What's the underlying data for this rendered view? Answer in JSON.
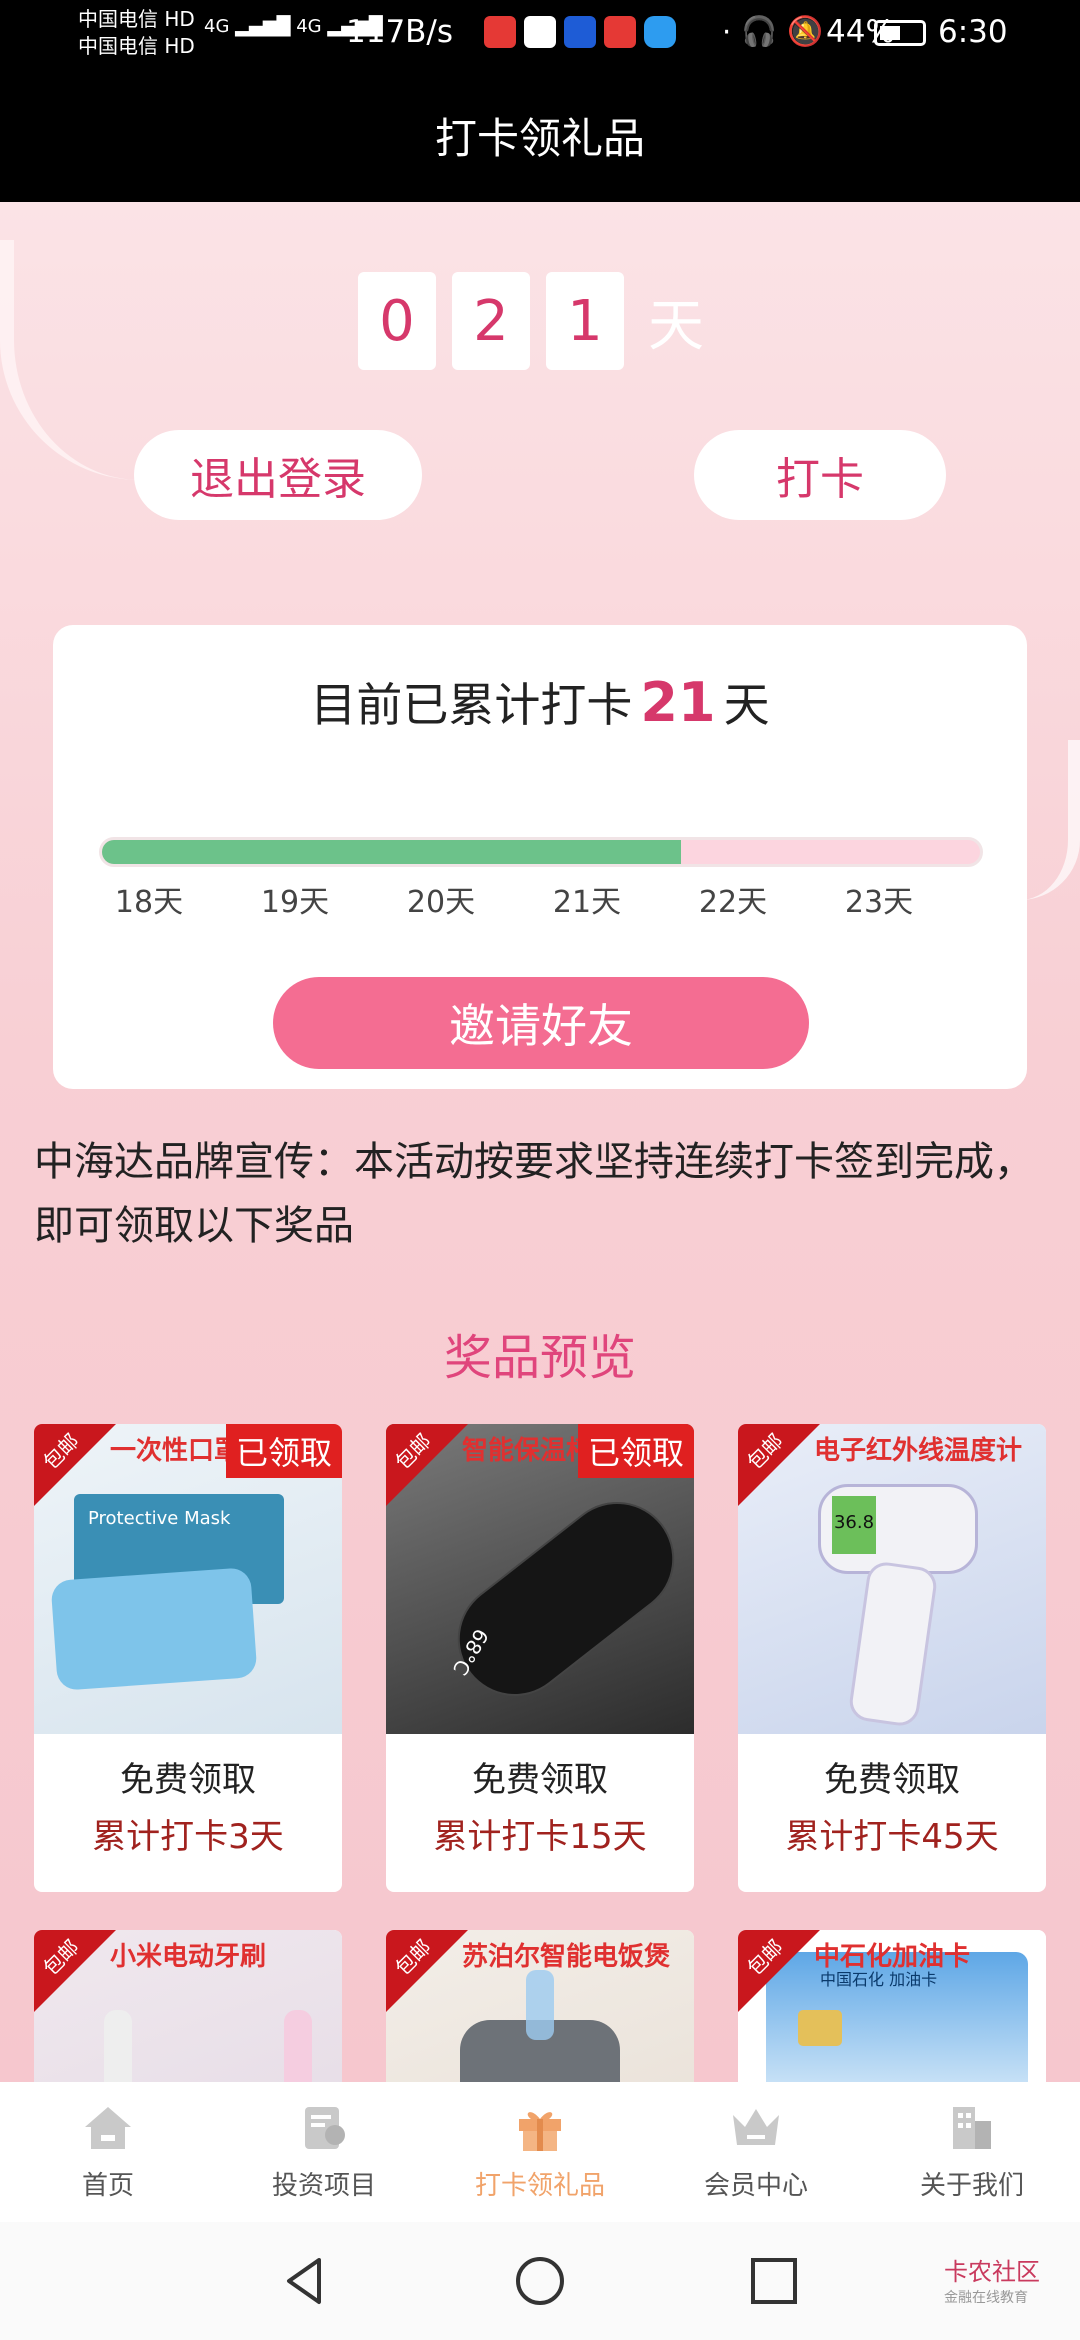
{
  "status_bar": {
    "carrier1": "中国电信",
    "carrier2": "中国电信",
    "hd": "HD",
    "network": "4G",
    "speed": "117B/s",
    "battery": "44%",
    "time": "6:30"
  },
  "title": "打卡领礼品",
  "counter": {
    "digits": [
      "0",
      "2",
      "1"
    ],
    "unit": "天"
  },
  "buttons": {
    "logout": "退出登录",
    "checkin": "打卡"
  },
  "progress_card": {
    "title_prefix": "目前已累计打卡",
    "days": "21",
    "title_suffix": "天",
    "progress_fraction": 0.66,
    "ticks": [
      "18天",
      "19天",
      "20天",
      "21天",
      "22天",
      "23天"
    ],
    "invite": "邀请好友"
  },
  "description": "中海达品牌宣传：本活动按要求坚持连续打卡签到完成，即可领取以下奖品",
  "section_title": "奖品预览",
  "prizes": [
    {
      "tag": "包邮",
      "name": "一次性口罩",
      "claimed": "已领取",
      "free": "免费领取",
      "req": "累计打卡3天",
      "image_text": "Protective Mask"
    },
    {
      "tag": "包邮",
      "name": "智能保温杯",
      "claimed": "已领取",
      "free": "免费领取",
      "req": "累计打卡15天",
      "image_text": "68°C"
    },
    {
      "tag": "包邮",
      "name": "电子红外线温度计",
      "claimed": "",
      "free": "免费领取",
      "req": "累计打卡45天",
      "image_text": "36.8"
    },
    {
      "tag": "包邮",
      "name": "小米电动牙刷",
      "claimed": "",
      "free": "",
      "req": ""
    },
    {
      "tag": "包邮",
      "name": "苏泊尔智能电饭煲",
      "claimed": "",
      "free": "",
      "req": ""
    },
    {
      "tag": "包邮",
      "name": "中石化加油卡",
      "claimed": "",
      "free": "",
      "req": "",
      "image_text": "中国石化 加油卡"
    }
  ],
  "tabs": [
    {
      "label": "首页",
      "icon": "home-icon"
    },
    {
      "label": "投资项目",
      "icon": "document-icon"
    },
    {
      "label": "打卡领礼品",
      "icon": "gift-icon",
      "active": true
    },
    {
      "label": "会员中心",
      "icon": "crown-icon"
    },
    {
      "label": "关于我们",
      "icon": "building-icon"
    }
  ],
  "watermark": {
    "title": "卡农社区",
    "sub": "金融在线教育"
  },
  "colors": {
    "accent": "#d6386b",
    "invite": "#f46d92",
    "progress_done": "#6cc28a",
    "progress_rest": "#fcd5df",
    "tab_active": "#f1a36a"
  }
}
